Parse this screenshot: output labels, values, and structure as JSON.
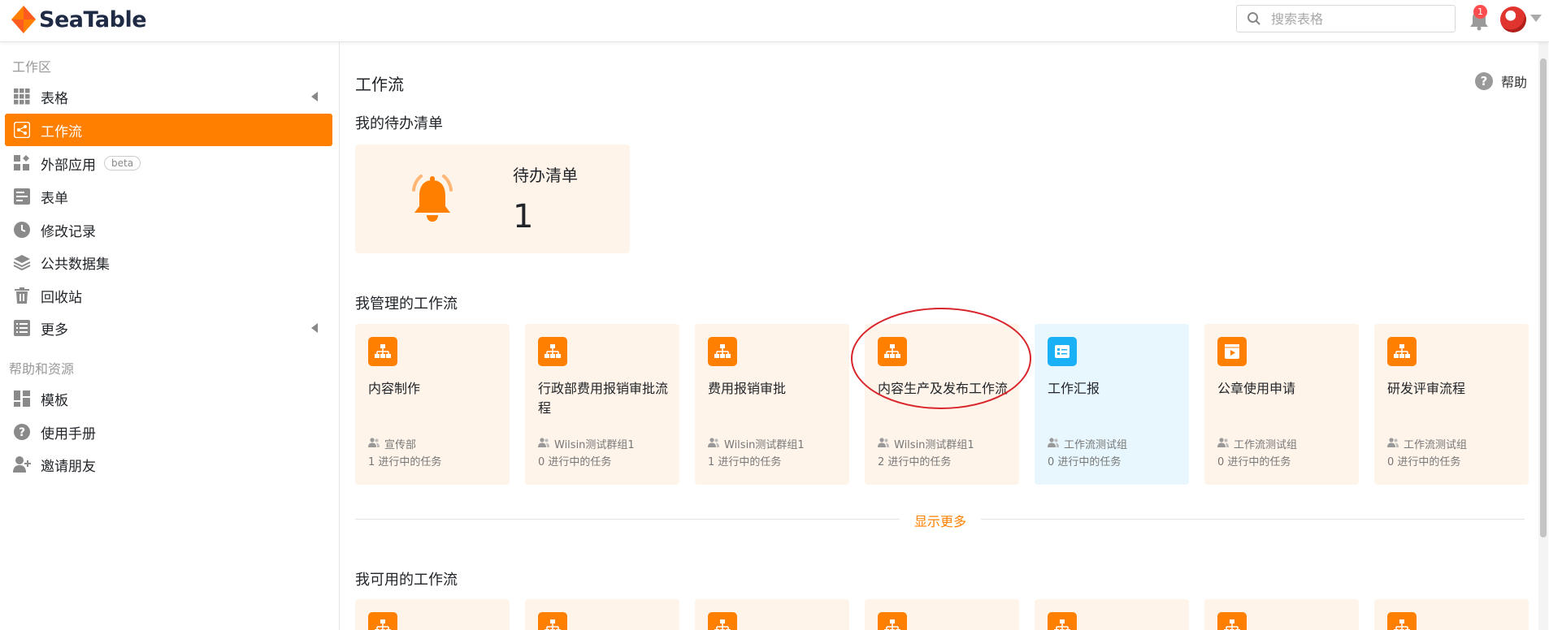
{
  "app": {
    "name": "SeaTable"
  },
  "header": {
    "search_placeholder": "搜索表格",
    "notification_count": "1"
  },
  "sidebar": {
    "section_workspace": "工作区",
    "items": [
      {
        "label": "表格",
        "icon": "grid-icon"
      },
      {
        "label": "工作流",
        "icon": "workflow-icon",
        "active": true
      },
      {
        "label": "外部应用",
        "icon": "apps-icon",
        "badge": "beta"
      },
      {
        "label": "表单",
        "icon": "form-icon"
      },
      {
        "label": "修改记录",
        "icon": "clock-icon"
      },
      {
        "label": "公共数据集",
        "icon": "layers-icon"
      },
      {
        "label": "回收站",
        "icon": "trash-icon"
      },
      {
        "label": "更多",
        "icon": "list-icon"
      }
    ],
    "section_help": "帮助和资源",
    "help_items": [
      {
        "label": "模板",
        "icon": "template-icon"
      },
      {
        "label": "使用手册",
        "icon": "question-icon"
      },
      {
        "label": "邀请朋友",
        "icon": "add-user-icon"
      }
    ]
  },
  "main": {
    "title": "工作流",
    "help_label": "帮助",
    "todo_section": "我的待办清单",
    "todo": {
      "label": "待办清单",
      "count": "1"
    },
    "managed_section": "我管理的工作流",
    "workflows": [
      {
        "name": "内容制作",
        "group": "宣传部",
        "tasks": "1 进行中的任务",
        "color": "orange"
      },
      {
        "name": "行政部费用报销审批流程",
        "group": "Wilsin测试群组1",
        "tasks": "0 进行中的任务",
        "color": "orange"
      },
      {
        "name": "费用报销审批",
        "group": "Wilsin测试群组1",
        "tasks": "1 进行中的任务",
        "color": "orange"
      },
      {
        "name": "内容生产及发布工作流",
        "group": "Wilsin测试群组1",
        "tasks": "2 进行中的任务",
        "color": "orange"
      },
      {
        "name": "工作汇报",
        "group": "工作流测试组",
        "tasks": "0 进行中的任务",
        "color": "blue"
      },
      {
        "name": "公章使用申请",
        "group": "工作流测试组",
        "tasks": "0 进行中的任务",
        "color": "orange"
      },
      {
        "name": "研发评审流程",
        "group": "工作流测试组",
        "tasks": "0 进行中的任务",
        "color": "orange"
      }
    ],
    "show_more": "显示更多",
    "available_section": "我可用的工作流"
  },
  "colors": {
    "accent": "#ff8000",
    "card_bg": "#fff4ea",
    "blue_card_bg": "#e8f7fd",
    "blue_icon": "#1ab0f5"
  }
}
